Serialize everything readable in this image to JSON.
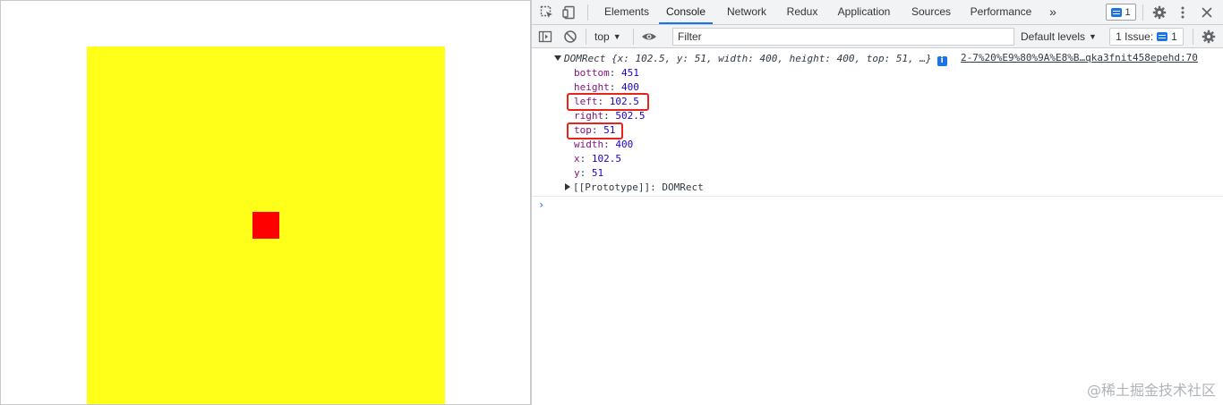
{
  "tabs": [
    {
      "label": "Elements",
      "active": false
    },
    {
      "label": "Console",
      "active": true
    },
    {
      "label": "Network",
      "active": false
    },
    {
      "label": "Redux",
      "active": false
    },
    {
      "label": "Application",
      "active": false
    },
    {
      "label": "Sources",
      "active": false
    },
    {
      "label": "Performance",
      "active": false
    }
  ],
  "tab_overflow": "»",
  "issues_badge_count": "1",
  "toolbar": {
    "context": "top",
    "filter_placeholder": "Filter",
    "levels": "Default levels",
    "issue_counter_label": "1 Issue:",
    "issue_counter_count": "1"
  },
  "console": {
    "summary": "DOMRect {x: 102.5, y: 51, width: 400, height: 400, top: 51, …}",
    "source": "2-7%20%E9%80%9A%E8%B…qka3fnit458epehd:70",
    "props": [
      {
        "key": "bottom",
        "value": "451"
      },
      {
        "key": "height",
        "value": "400"
      },
      {
        "key": "left",
        "value": "102.5"
      },
      {
        "key": "right",
        "value": "502.5"
      },
      {
        "key": "top",
        "value": "51"
      },
      {
        "key": "width",
        "value": "400"
      },
      {
        "key": "x",
        "value": "102.5"
      },
      {
        "key": "y",
        "value": "51"
      }
    ],
    "prototype_key": "[[Prototype]]",
    "prototype_value": "DOMRect",
    "prompt": "›"
  },
  "colors": {
    "yellow_box": "#ffff1a",
    "red_box": "#ff0000",
    "highlight": "#e8231a",
    "accent": "#1a73e8"
  },
  "watermark": "@稀土掘金技术社区"
}
